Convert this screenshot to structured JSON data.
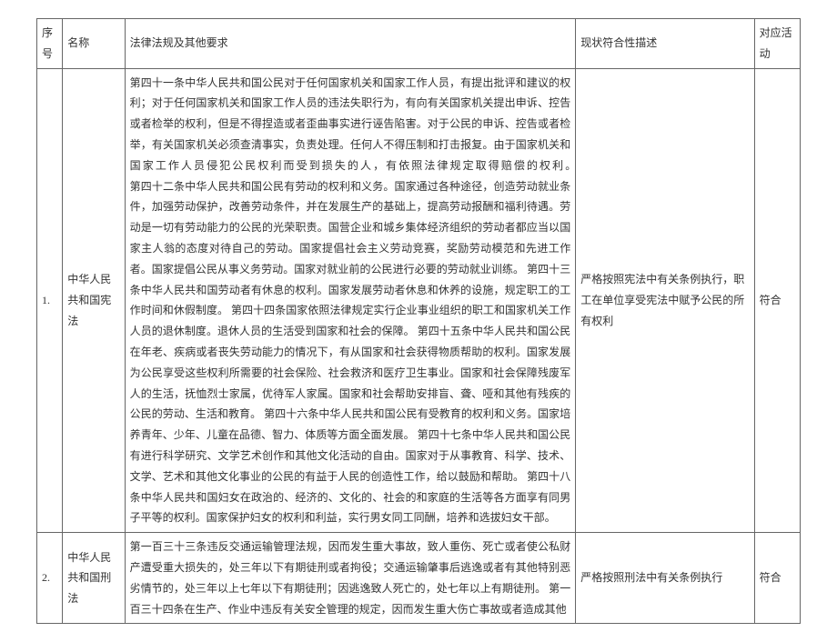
{
  "headers": {
    "seq": "序号",
    "name": "名称",
    "req": "法律法规及其他要求",
    "status": "现状符合性描述",
    "act": "对应活动"
  },
  "rows": [
    {
      "seq": "1.",
      "name": "中华人民共和国宪法",
      "req": "第四十一条中华人民共和国公民对于任何国家机关和国家工作人员，有提出批评和建议的权利；对于任何国家机关和国家工作人员的违法失职行为，有向有关国家机关提出申诉、控告或者检举的权利，但是不得捏造或者歪曲事实进行诬告陷害。对于公民的申诉、控告或者检举，有关国家机关必须查清事实，负责处理。任何人不得压制和打击报复。由于国家机关和国家工作人员侵犯公民权利而受到损失的人，有依照法律规定取得赔偿的权利。　　　　　　　　　第四十二条中华人民共和国公民有劳动的权利和义务。国家通过各种途径，创造劳动就业条件，加强劳动保护，改善劳动条件，并在发展生产的基础上，提高劳动报酬和福利待遇。劳动是一切有劳动能力的公民的光荣职责。国营企业和城乡集体经济组织的劳动者都应当以国家主人翁的态度对待自己的劳动。国家提倡社会主义劳动竞赛，奖励劳动模范和先进工作者。国家提倡公民从事义务劳动。国家对就业前的公民进行必要的劳动就业训练。\n第四十三条中华人民共和国劳动者有休息的权利。国家发展劳动者休息和休养的设施，规定职工的工作时间和休假制度。\n第四十四条国家依照法律规定实行企业事业组织的职工和国家机关工作人员的退休制度。退休人员的生活受到国家和社会的保障。\n第四十五条中华人民共和国公民在年老、疾病或者丧失劳动能力的情况下，有从国家和社会获得物质帮助的权利。国家发展为公民享受这些权利所需要的社会保险、社会救济和医疗卫生事业。国家和社会保障残废军人的生活，抚恤烈士家属，优待军人家属。国家和社会帮助安排盲、聋、哑和其他有残疾的公民的劳动、生活和教育。\n第四十六条中华人民共和国公民有受教育的权利和义务。国家培养青年、少年、儿童在品德、智力、体质等方面全面发展。\n第四十七条中华人民共和国公民有进行科学研究、文学艺术创作和其他文化活动的自由。国家对于从事教育、科学、技术、文学、艺术和其他文化事业的公民的有益于人民的创造性工作，给以鼓励和帮助。\n第四十八条中华人民共和国妇女在政治的、经济的、文化的、社会的和家庭的生活等各方面享有同男子平等的权利。国家保护妇女的权利和利益，实行男女同工同酬，培养和选拔妇女干部。",
      "status": "严格按照宪法中有关条例执行，职工在单位享受宪法中赋予公民的所有权利",
      "act": "符合"
    },
    {
      "seq": "2.",
      "name": "中华人民共和国刑法",
      "req": "第一百三十三条违反交通运输管理法规，因而发生重大事故，致人重伤、死亡或者使公私财产遭受重大损失的，处三年以下有期徒刑或者拘役；交通运输肇事后逃逸或者有其他特别恶劣情节的，处三年以上七年以下有期徒刑；因逃逸致人死亡的，处七年以上有期徒刑。\n第一百三十四条在生产、作业中违反有关安全管理的规定，因而发生重大伤亡事故或者造成其他",
      "status": "严格按照刑法中有关条例执行",
      "act": "符合"
    }
  ]
}
